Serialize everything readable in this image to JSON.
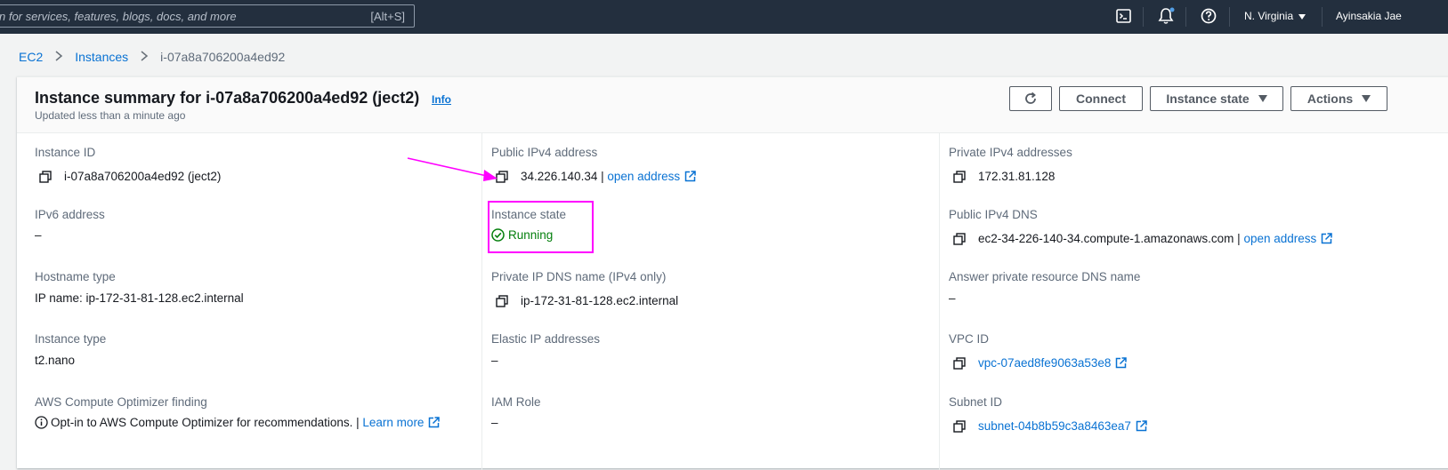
{
  "topbar": {
    "search_placeholder": "n for services, features, blogs, docs, and more",
    "search_shortcut": "[Alt+S]",
    "region": "N. Virginia",
    "user": "Ayinsakia Jae"
  },
  "breadcrumb": {
    "items": [
      "EC2",
      "Instances"
    ],
    "current": "i-07a8a706200a4ed92"
  },
  "summary": {
    "title": "Instance summary for i-07a8a706200a4ed92 (ject2)",
    "info": "Info",
    "updated": "Updated less than a minute ago",
    "buttons": {
      "connect": "Connect",
      "instance_state": "Instance state",
      "actions": "Actions"
    }
  },
  "details": {
    "col1": [
      {
        "label": "Instance ID",
        "value": "i-07a8a706200a4ed92 (ject2)"
      },
      {
        "label": "IPv6 address",
        "value": "–"
      },
      {
        "label": "Hostname type",
        "value": "IP name: ip-172-31-81-128.ec2.internal"
      },
      {
        "label": "Instance type",
        "value": "t2.nano"
      },
      {
        "label": "AWS Compute Optimizer finding",
        "value": "Opt-in to AWS Compute Optimizer for recommendations. |",
        "link": "Learn more"
      }
    ],
    "col2": [
      {
        "label": "Public IPv4 address",
        "value": "34.226.140.34 |",
        "link": "open address"
      },
      {
        "label": "Instance state",
        "value": "Running"
      },
      {
        "label": "Private IP DNS name (IPv4 only)",
        "value": "ip-172-31-81-128.ec2.internal"
      },
      {
        "label": "Elastic IP addresses",
        "value": "–"
      },
      {
        "label": "IAM Role",
        "value": "–"
      }
    ],
    "col3": [
      {
        "label": "Private IPv4 addresses",
        "value": "172.31.81.128"
      },
      {
        "label": "Public IPv4 DNS",
        "value": "ec2-34-226-140-34.compute-1.amazonaws.com |",
        "link": "open address"
      },
      {
        "label": "Answer private resource DNS name",
        "value": "–"
      },
      {
        "label": "VPC ID",
        "link": "vpc-07aed8fe9063a53e8"
      },
      {
        "label": "Subnet ID",
        "link": "subnet-04b8b59c3a8463ea7"
      }
    ]
  },
  "colors": {
    "link": "#0972d3",
    "running": "#037f0c",
    "highlight": "#ff00ff",
    "topbar": "#232f3e"
  }
}
